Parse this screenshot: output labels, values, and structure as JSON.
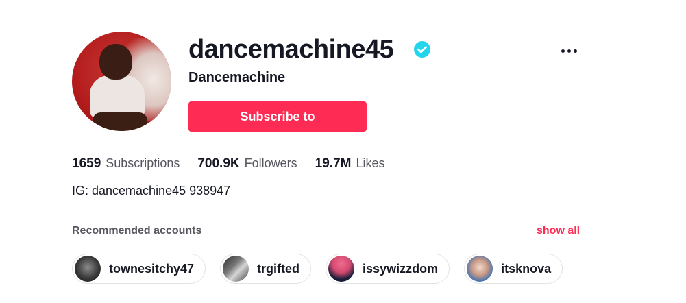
{
  "profile": {
    "username": "dancemachine45",
    "nickname": "Dancemachine",
    "verified": true,
    "subscribe_label": "Subscribe to",
    "more_icon": "more-horizontal-icon",
    "bio": "IG: dancemachine45 938947"
  },
  "stats": [
    {
      "value": "1659",
      "label": "Subscriptions"
    },
    {
      "value": "700.9K",
      "label": "Followers"
    },
    {
      "value": "19.7M",
      "label": "Likes"
    }
  ],
  "recommended": {
    "title": "Recommended accounts",
    "show_all_label": "show all",
    "accounts": [
      {
        "name": "townesitchy47"
      },
      {
        "name": "trgifted"
      },
      {
        "name": "issywizzdom"
      },
      {
        "name": "itsknova"
      }
    ]
  },
  "colors": {
    "accent": "#fe2c55",
    "verified": "#20d5ec",
    "text": "#161823",
    "muted": "#57575f"
  }
}
